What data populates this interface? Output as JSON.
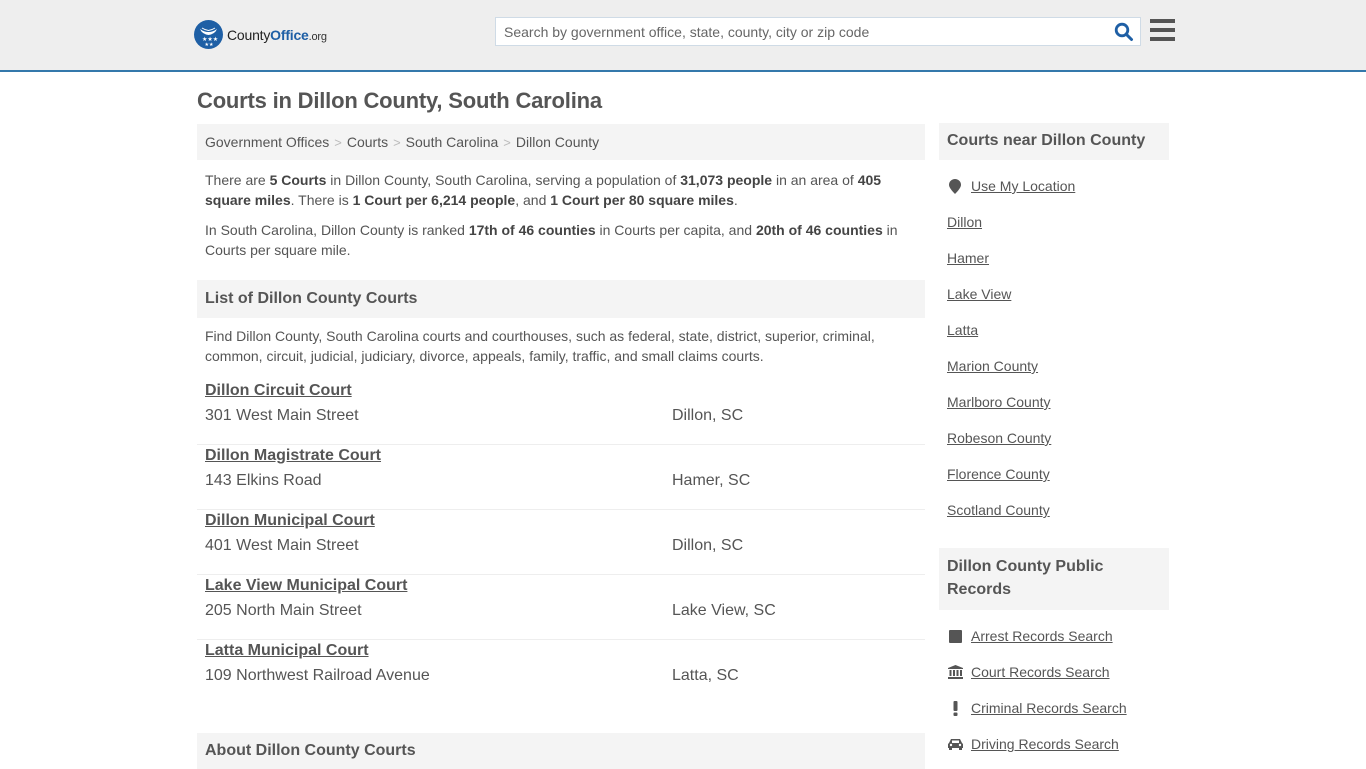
{
  "header": {
    "logo": {
      "name_part1": "County",
      "name_part2": "Office",
      "name_part3": ".org"
    },
    "search": {
      "placeholder": "Search by government office, state, county, city or zip code",
      "value": "",
      "icon": "search-icon"
    },
    "menu_icon": "hamburger-menu-icon"
  },
  "page": {
    "title": "Courts in Dillon County, South Carolina"
  },
  "breadcrumb": [
    {
      "label": "Government Offices"
    },
    {
      "label": "Courts"
    },
    {
      "label": "South Carolina"
    },
    {
      "label": "Dillon County"
    }
  ],
  "breadcrumb_separator": ">",
  "summary": {
    "p1": {
      "t1": "There are ",
      "b1": "5 Courts",
      "t2": " in Dillon County, South Carolina, serving a population of ",
      "b2": "31,073 people",
      "t3": " in an area of ",
      "b3": "405 square miles",
      "t4": ". There is ",
      "b4": "1 Court per 6,214 people",
      "t5": ", and ",
      "b5": "1 Court per 80 square miles",
      "t6": "."
    },
    "p2": {
      "t1": "In South Carolina, Dillon County is ranked ",
      "b1": "17th of 46 counties",
      "t2": " in Courts per capita, and ",
      "b2": "20th of 46 counties",
      "t3": " in Courts per square mile."
    }
  },
  "list_section": {
    "heading": "List of Dillon County Courts",
    "intro": "Find Dillon County, South Carolina courts and courthouses, such as federal, state, district, superior, criminal, common, circuit, judicial, judiciary, divorce, appeals, family, traffic, and small claims courts.",
    "courts": [
      {
        "name": "Dillon Circuit Court",
        "address": "301 West Main Street",
        "city": "Dillon, SC"
      },
      {
        "name": "Dillon Magistrate Court",
        "address": "143 Elkins Road",
        "city": "Hamer, SC"
      },
      {
        "name": "Dillon Municipal Court",
        "address": "401 West Main Street",
        "city": "Dillon, SC"
      },
      {
        "name": "Lake View Municipal Court",
        "address": "205 North Main Street",
        "city": "Lake View, SC"
      },
      {
        "name": "Latta Municipal Court",
        "address": "109 Northwest Railroad Avenue",
        "city": "Latta, SC"
      }
    ]
  },
  "about_section": {
    "heading": "About Dillon County Courts"
  },
  "sidebar": {
    "nearby": {
      "heading": "Courts near Dillon County",
      "use_location": {
        "label": "Use My Location",
        "icon": "map-marker-icon"
      },
      "links": [
        {
          "label": "Dillon"
        },
        {
          "label": "Hamer"
        },
        {
          "label": "Lake View"
        },
        {
          "label": "Latta"
        },
        {
          "label": "Marion County"
        },
        {
          "label": "Marlboro County"
        },
        {
          "label": "Robeson County"
        },
        {
          "label": "Florence County"
        },
        {
          "label": "Scotland County"
        }
      ]
    },
    "records": {
      "heading": "Dillon County Public Records",
      "links": [
        {
          "label": "Arrest Records Search",
          "icon": "square-icon"
        },
        {
          "label": "Court Records Search",
          "icon": "courthouse-icon"
        },
        {
          "label": "Criminal Records Search",
          "icon": "exclamation-icon"
        },
        {
          "label": "Driving Records Search",
          "icon": "car-icon"
        }
      ]
    }
  },
  "colors": {
    "brand_blue": "#1e5fa5",
    "header_border": "#3478ab",
    "header_bg": "#eeeeee",
    "panel_bg": "#f4f4f4",
    "text": "#555555"
  }
}
